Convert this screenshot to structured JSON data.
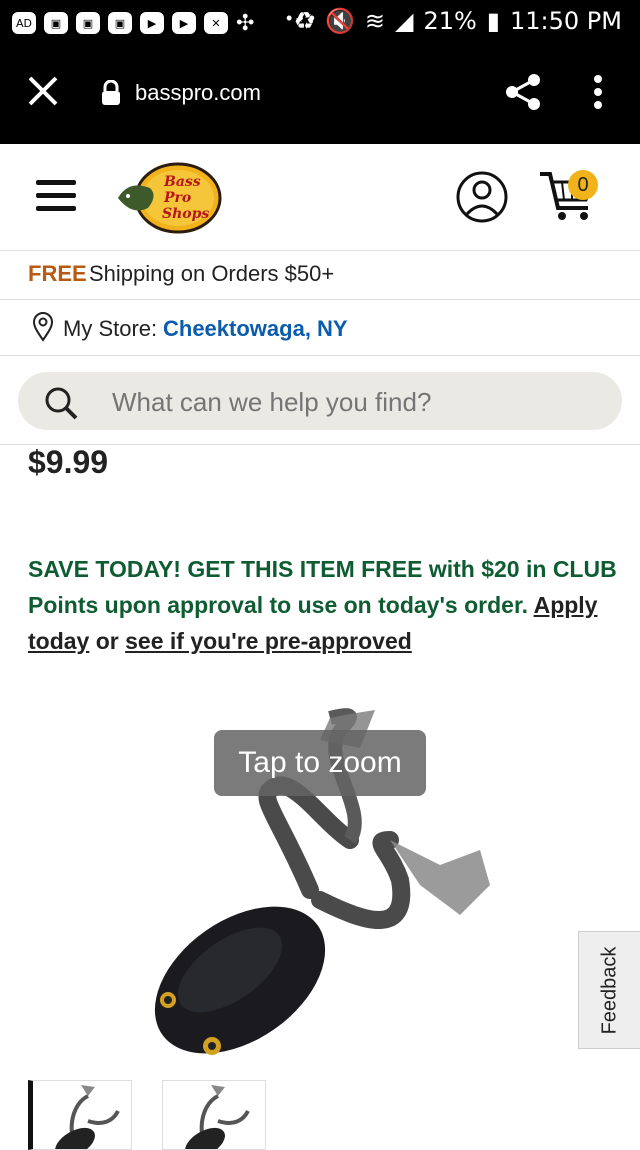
{
  "status_bar": {
    "battery": "21%",
    "time": "11:50 PM",
    "left_icons": [
      "ad-icon",
      "android-icon",
      "android-icon",
      "android-icon",
      "play-icon",
      "play-icon",
      "close-box-icon",
      "pinwheel-icon"
    ],
    "dots": "• • •"
  },
  "browser": {
    "url": "basspro.com"
  },
  "header": {
    "cart_count": "0"
  },
  "promo": {
    "free": "FREE",
    "text": "Shipping on Orders $50+"
  },
  "store": {
    "label": "My Store:",
    "name": "Cheektowaga, NY"
  },
  "search": {
    "placeholder": "What can we help you find?"
  },
  "product": {
    "price": "$9.99",
    "club_text": "SAVE TODAY! GET THIS ITEM FREE with $20 in CLUB Points upon approval to use on today's order.",
    "apply_link": "Apply today",
    "or_text": "or",
    "preapproved_link": "see if you're pre-approved",
    "zoom_label": "Tap to zoom"
  },
  "feedback": {
    "label": "Feedback"
  },
  "colors": {
    "accent_orange": "#b85a12",
    "store_blue": "#0b5cad",
    "promo_green": "#0f5c32",
    "cart_badge": "#f0b31a"
  }
}
